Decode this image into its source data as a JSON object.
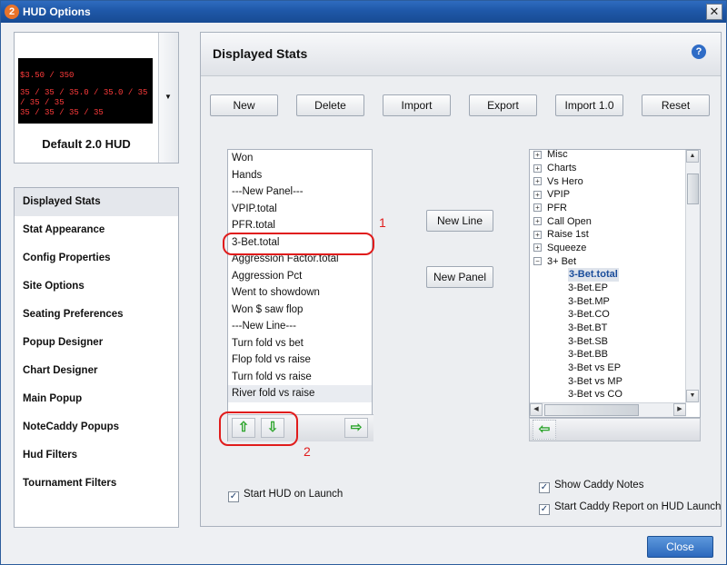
{
  "window": {
    "title": "HUD Options",
    "logo": "2",
    "close_glyph": "✕"
  },
  "hud": {
    "name": "Default 2.0 HUD",
    "preview_line1": "$3.50 / 350",
    "preview_line2": "35 / 35 / 35.0 / 35.0 / 35 / 35 / 35",
    "preview_line3": "35 / 35 / 35 / 35"
  },
  "nav": {
    "items": [
      "Displayed Stats",
      "Stat Appearance",
      "Config Properties",
      "Site Options",
      "Seating Preferences",
      "Popup Designer",
      "Chart Designer",
      "Main Popup",
      "NoteCaddy Popups",
      "Hud Filters",
      "Tournament Filters"
    ],
    "active": "Displayed Stats"
  },
  "panel": {
    "title": "Displayed Stats",
    "help_icon": "?",
    "buttons": {
      "new": "New",
      "delete": "Delete",
      "import": "Import",
      "export": "Export",
      "import10": "Import 1.0",
      "reset": "Reset"
    },
    "new_line": "New Line",
    "new_panel": "New Panel"
  },
  "stats_list": {
    "items": [
      "Won",
      "Hands",
      "---New Panel---",
      "VPIP.total",
      "PFR.total",
      "3-Bet.total",
      "Aggression Factor.total",
      "Aggression Pct",
      "Went to showdown",
      "Won $ saw flop",
      "---New Line---",
      "Turn fold vs bet",
      "Flop fold vs raise",
      "Turn fold vs raise",
      "River fold vs raise"
    ],
    "selected": "3-Bet.total"
  },
  "tree": {
    "groups": [
      "Misc",
      "Charts",
      "Vs Hero",
      "VPIP",
      "PFR",
      "Call Open",
      "Raise 1st",
      "Squeeze",
      "3+ Bet"
    ],
    "expanded": "3+ Bet",
    "leaves": [
      "3-Bet.total",
      "3-Bet.EP",
      "3-Bet.MP",
      "3-Bet.CO",
      "3-Bet.BT",
      "3-Bet.SB",
      "3-Bet.BB",
      "3-Bet vs EP",
      "3-Bet vs MP",
      "3-Bet vs CO"
    ],
    "selected_leaf": "3-Bet.total"
  },
  "options": {
    "start_hud": {
      "label": "Start HUD on Launch",
      "checked": true
    },
    "show_caddy": {
      "label": "Show Caddy Notes",
      "checked": true
    },
    "caddy_report": {
      "label": "Start Caddy Report on HUD Launch",
      "checked": true
    }
  },
  "annotations": {
    "one": "1",
    "two": "2"
  },
  "footer": {
    "close": "Close"
  },
  "colors": {
    "accent": "#2f6cbf",
    "annotation": "#e01c1c",
    "arrow": "#2ea52e"
  }
}
